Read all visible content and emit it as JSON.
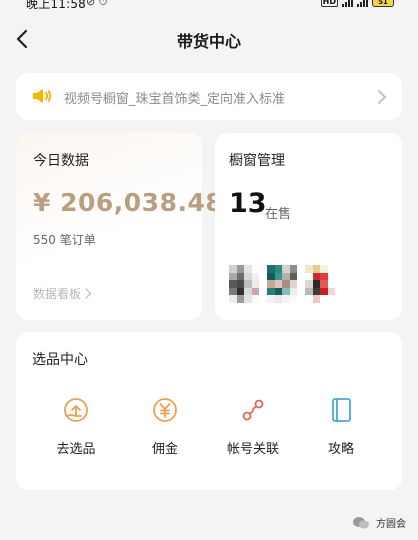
{
  "status_bar": {
    "time": "晚上11:58",
    "hd": "HD",
    "battery": "51"
  },
  "nav": {
    "title": "带货中心"
  },
  "banner": {
    "text": "视频号橱窗_珠宝首饰类_定向准入标准"
  },
  "today": {
    "label": "今日数据",
    "amount": "¥ 206,038.48",
    "orders": "550 笔订单",
    "board_link": "数据看板"
  },
  "window": {
    "label": "橱窗管理",
    "count": "13",
    "unit": "在售"
  },
  "selection": {
    "label": "选品中心",
    "tools": [
      {
        "label": "去选品",
        "icon": "hand-coin-icon"
      },
      {
        "label": "佣金",
        "icon": "yen-coin-icon"
      },
      {
        "label": "帐号关联",
        "icon": "link-nodes-icon"
      },
      {
        "label": "攻略",
        "icon": "book-icon"
      }
    ]
  },
  "colors": {
    "accent": "#e9a057",
    "amount": "#b89f82",
    "speaker": "#f5b800",
    "book": "#4aa7d8",
    "link": "#e06a55"
  },
  "watermark": {
    "text": "方圆会"
  }
}
